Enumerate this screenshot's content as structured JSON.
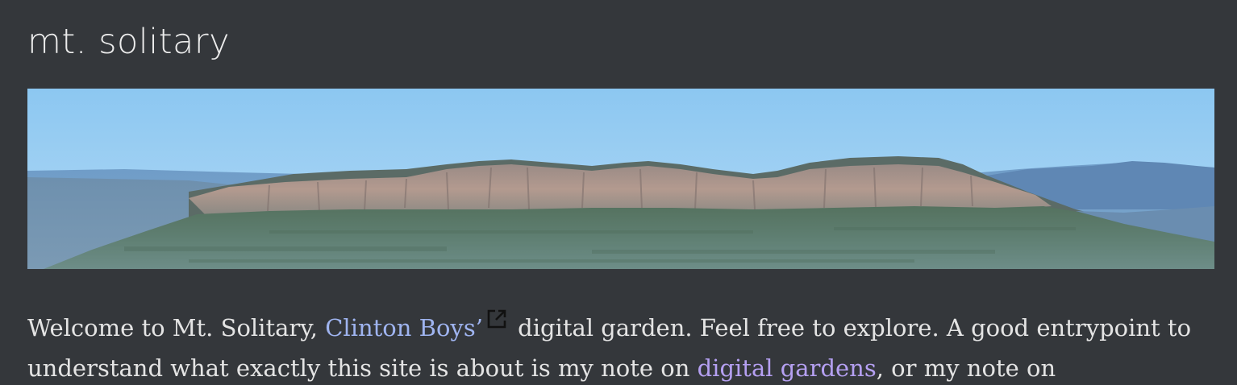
{
  "header": {
    "site_title": "mt. solitary"
  },
  "banner": {
    "image_subject": "panoramic photo of Mt. Solitary plateau under blue sky"
  },
  "intro": {
    "text_1": "Welcome to Mt. Solitary, ",
    "author_link": "Clinton Boys’",
    "text_2": " digital garden. Feel free to explore. A good entrypoint to",
    "text_3": "understand what exactly this site is about is my note on ",
    "gardens_link": "digital gardens",
    "text_4": ", or my note on"
  },
  "colors": {
    "background": "#34373b",
    "external_link": "#9fb4f0",
    "internal_link": "#b5a0f2",
    "text": "#e4e4e4"
  },
  "icons": {
    "external": "external-link-icon"
  }
}
